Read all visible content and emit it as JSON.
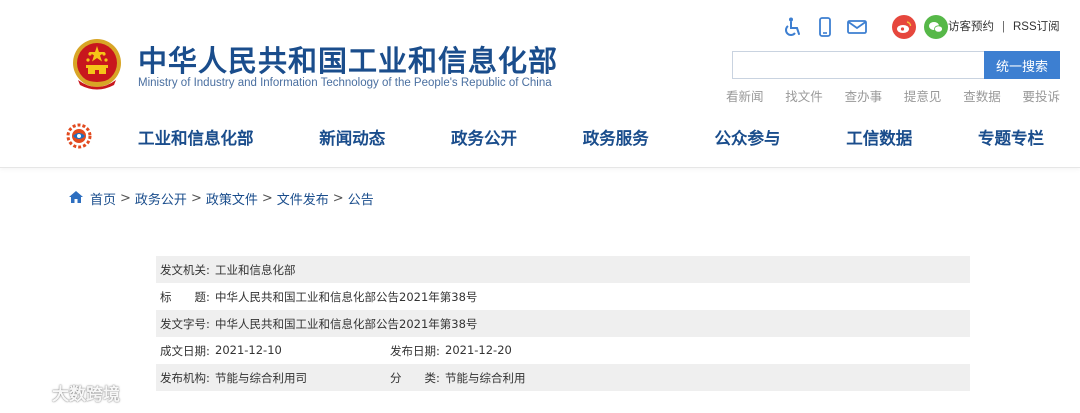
{
  "header": {
    "site_title": "中华人民共和国工业和信息化部",
    "site_subtitle": "Ministry of Industry and Information Technology of the People's Republic of China",
    "icons": [
      "accessibility-icon",
      "mobile-icon",
      "mail-icon",
      "weibo-icon",
      "wechat-icon"
    ],
    "top_links": {
      "visitor": "访客预约",
      "separator": "|",
      "rss": "RSS订阅"
    },
    "search": {
      "placeholder": "",
      "button": "统一搜索"
    },
    "quick_links": [
      "看新闻",
      "找文件",
      "查办事",
      "提意见",
      "查数据",
      "要投诉"
    ],
    "nav": [
      "工业和信息化部",
      "新闻动态",
      "政务公开",
      "政务服务",
      "公众参与",
      "工信数据",
      "专题专栏"
    ]
  },
  "breadcrumb": [
    "首页",
    "政务公开",
    "政策文件",
    "文件发布",
    "公告"
  ],
  "breadcrumb_sep": ">",
  "document_info": {
    "issuer_label": "发文机关:",
    "issuer": "工业和信息化部",
    "title_label": "标　　题:",
    "title": "中华人民共和国工业和信息化部公告2021年第38号",
    "doc_no_label": "发文字号:",
    "doc_no": "中华人民共和国工业和信息化部公告2021年第38号",
    "written_date_label": "成文日期:",
    "written_date": "2021-12-10",
    "publish_date_label": "发布日期:",
    "publish_date": "2021-12-20",
    "org_label": "发布机构:",
    "org": "节能与综合利用司",
    "category_label": "分　　类:",
    "category": "节能与综合利用"
  },
  "watermark": "大数跨境",
  "colors": {
    "brand_blue": "#1a4d8c",
    "button_blue": "#3d7fd1",
    "row_shade": "#efefef",
    "weibo_red": "#e6473d",
    "wechat_green": "#56b848"
  }
}
